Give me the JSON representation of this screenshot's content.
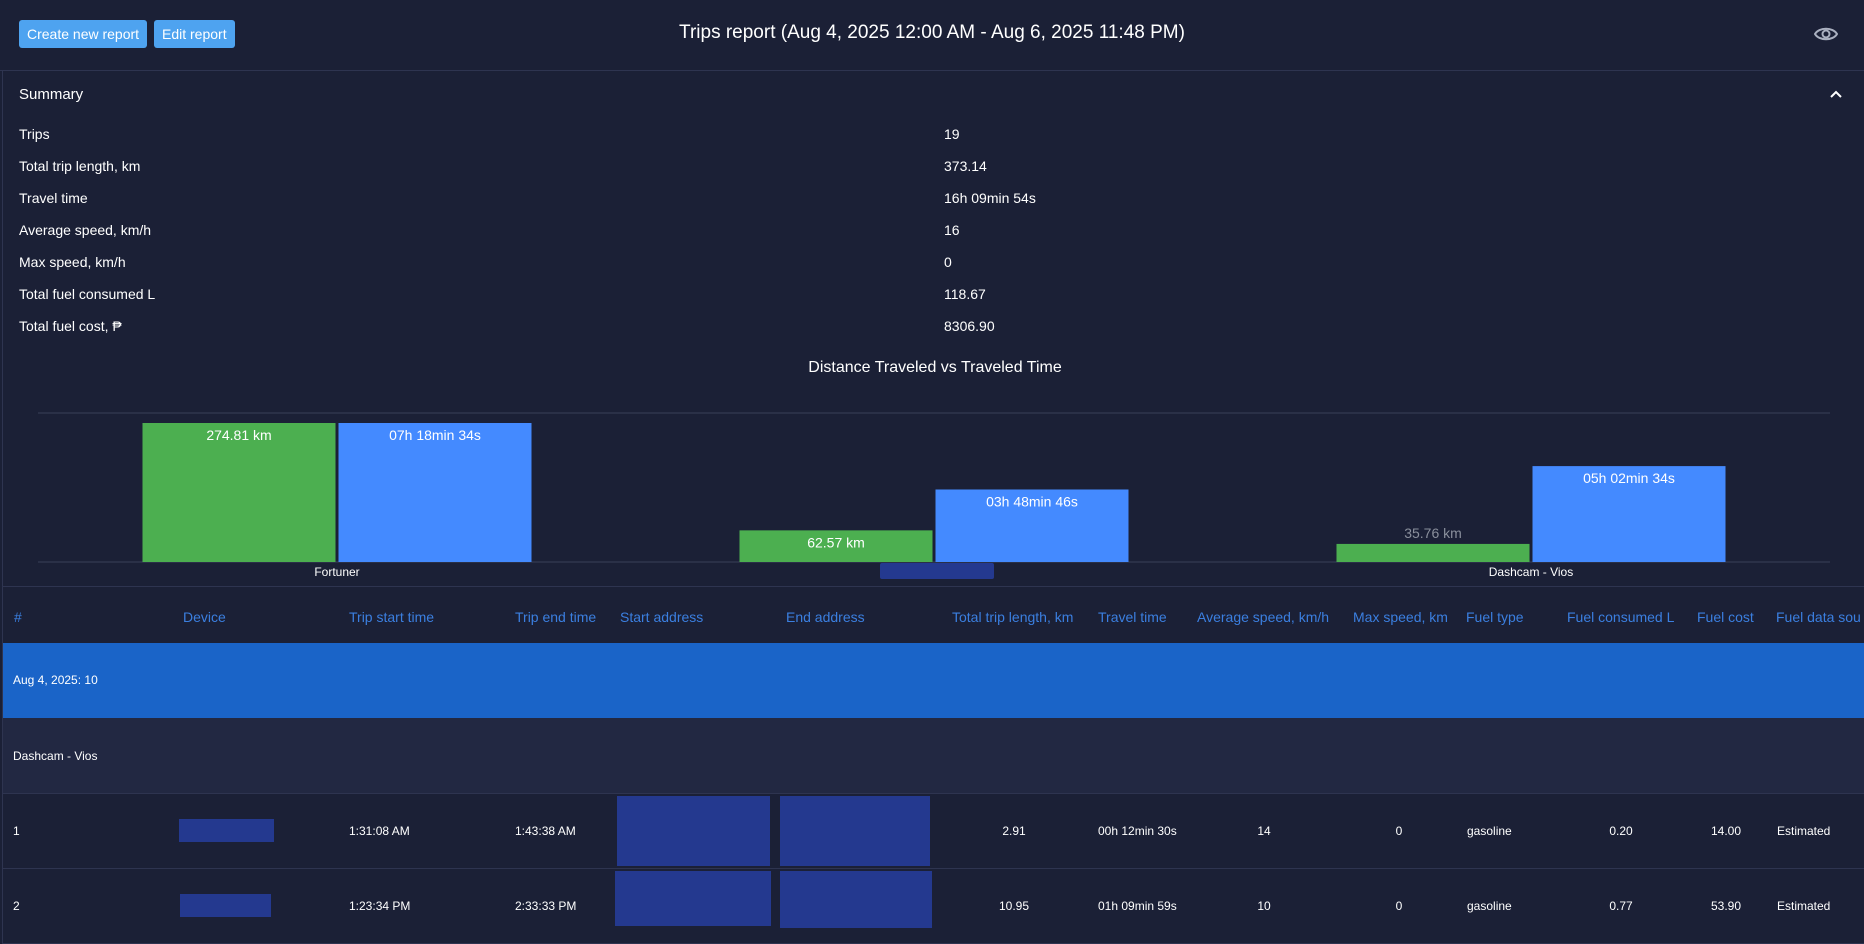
{
  "toolbar": {
    "create_label": "Create new report",
    "edit_label": "Edit report",
    "title": "Trips report (Aug 4, 2025 12:00 AM - Aug 6, 2025 11:48 PM)",
    "view_icon": "eye-icon"
  },
  "summary": {
    "title": "Summary",
    "collapse_icon": "chevron-up-icon",
    "rows": [
      {
        "label": "Trips",
        "value": "19"
      },
      {
        "label": "Total trip length, km",
        "value": "373.14"
      },
      {
        "label": "Travel time",
        "value": "16h 09min 54s"
      },
      {
        "label": "Average speed, km/h",
        "value": "16"
      },
      {
        "label": "Max speed, km/h",
        "value": "0"
      },
      {
        "label": "Total fuel consumed L",
        "value": "118.67"
      },
      {
        "label": "Total fuel cost, ₱",
        "value": "8306.90"
      }
    ]
  },
  "chart_data": {
    "type": "bar",
    "title": "Distance Traveled vs Traveled Time",
    "categories": [
      "Fortuner",
      "",
      "Dashcam - Vios"
    ],
    "series": [
      {
        "values": [
          274.81,
          62.57,
          35.76
        ],
        "labels": [
          "274.81 km",
          "62.57 km",
          "35.76 km"
        ],
        "color": "#4caf50"
      },
      {
        "values": [
          26314,
          13726,
          18154
        ],
        "labels": [
          "07h 18min 34s",
          "03h 48min 46s",
          "05h 02min 34s"
        ],
        "color": "#448aff"
      }
    ],
    "grid": true
  },
  "table": {
    "headers": [
      "#",
      "Device",
      "Trip start time",
      "Trip end time",
      "Start address",
      "End address",
      "Total trip length, km",
      "Travel time",
      "Average speed, km/h",
      "Max speed, km",
      "Fuel type",
      "Fuel consumed L",
      "Fuel cost",
      "Fuel data sou"
    ],
    "group": "Aug 4, 2025: 10",
    "device_group": "Dashcam - Vios",
    "rows": [
      {
        "num": "1",
        "start": "1:31:08 AM",
        "end": "1:43:38 AM",
        "length": "2.91",
        "time": "00h 12min 30s",
        "avg": "14",
        "max": "0",
        "fuel_type": "gasoline",
        "fuel_l": "0.20",
        "cost": "14.00",
        "source": "Estimated"
      },
      {
        "num": "2",
        "start": "1:23:34 PM",
        "end": "2:33:33 PM",
        "length": "10.95",
        "time": "01h 09min 59s",
        "avg": "10",
        "max": "0",
        "fuel_type": "gasoline",
        "fuel_l": "0.77",
        "cost": "53.90",
        "source": "Estimated"
      }
    ]
  },
  "colors": {
    "accent": "#4ea3f0",
    "group_row": "#1a64c8",
    "header_text": "#3b7fe0",
    "background": "#1b2036"
  }
}
